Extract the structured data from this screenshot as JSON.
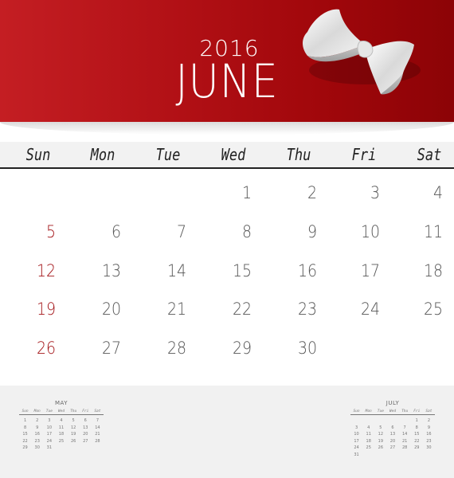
{
  "calendar": {
    "year": "2016",
    "month": "JUNE",
    "colors": {
      "header_red": "#b11015",
      "sunday_red": "#a31418",
      "day_gray": "#555555",
      "footer_bg": "#f1f1f1"
    },
    "weekdays": [
      "Sun",
      "Mon",
      "Tue",
      "Wed",
      "Thu",
      "Fri",
      "Sat"
    ],
    "weeks": [
      [
        "",
        "",
        "",
        "1",
        "2",
        "3",
        "4"
      ],
      [
        "5",
        "6",
        "7",
        "8",
        "9",
        "10",
        "11"
      ],
      [
        "12",
        "13",
        "14",
        "15",
        "16",
        "17",
        "18"
      ],
      [
        "19",
        "20",
        "21",
        "22",
        "23",
        "24",
        "25"
      ],
      [
        "26",
        "27",
        "28",
        "29",
        "30",
        "",
        ""
      ]
    ],
    "decoration": "white-ribbon-bow-icon"
  },
  "mini_calendars": {
    "previous": {
      "title": "MAY",
      "weekdays": [
        "Sun",
        "Mon",
        "Tue",
        "Wed",
        "Thu",
        "Fri",
        "Sat"
      ],
      "weeks": [
        [
          "1",
          "2",
          "3",
          "4",
          "5",
          "6",
          "7"
        ],
        [
          "8",
          "9",
          "10",
          "11",
          "12",
          "13",
          "14"
        ],
        [
          "15",
          "16",
          "17",
          "18",
          "19",
          "20",
          "21"
        ],
        [
          "22",
          "23",
          "24",
          "25",
          "26",
          "27",
          "28"
        ],
        [
          "29",
          "30",
          "31",
          "",
          "",
          "",
          ""
        ]
      ]
    },
    "next": {
      "title": "JULY",
      "weekdays": [
        "Sun",
        "Mon",
        "Tue",
        "Wed",
        "Thu",
        "Fri",
        "Sat"
      ],
      "weeks": [
        [
          "",
          "",
          "",
          "",
          "",
          "1",
          "2"
        ],
        [
          "3",
          "4",
          "5",
          "6",
          "7",
          "8",
          "9"
        ],
        [
          "10",
          "11",
          "12",
          "13",
          "14",
          "15",
          "16"
        ],
        [
          "17",
          "18",
          "19",
          "20",
          "21",
          "22",
          "23"
        ],
        [
          "24",
          "25",
          "26",
          "27",
          "28",
          "29",
          "30"
        ],
        [
          "31",
          "",
          "",
          "",
          "",
          "",
          ""
        ]
      ]
    }
  }
}
